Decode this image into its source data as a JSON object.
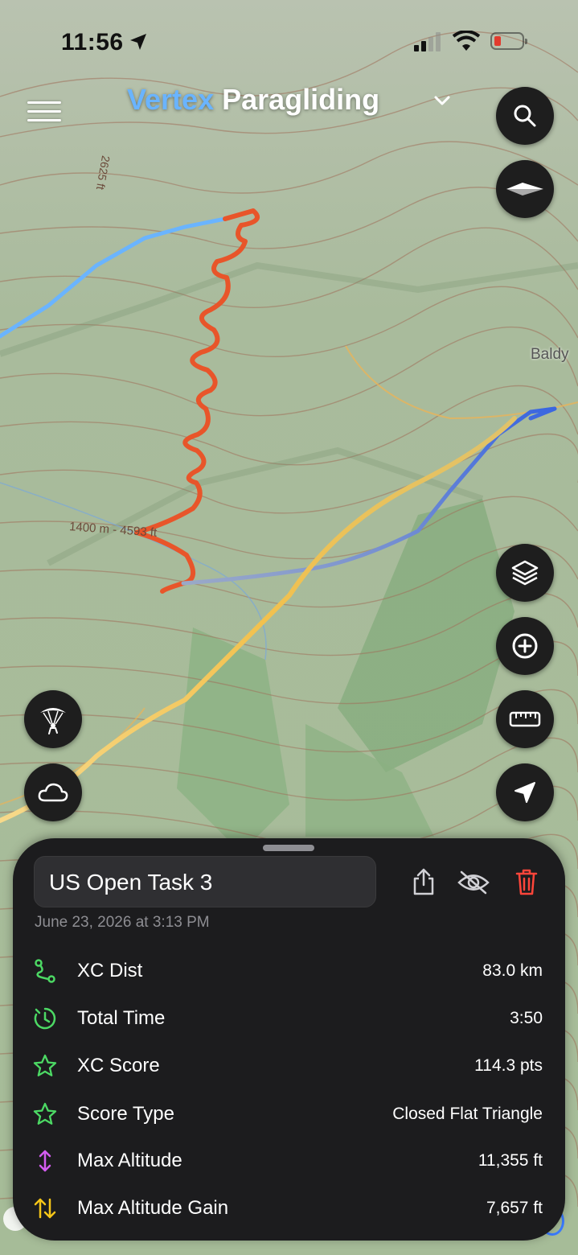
{
  "status_bar": {
    "time": "11:56"
  },
  "header": {
    "brand": "Vertex",
    "product": " Paragliding"
  },
  "map": {
    "place_label": "Baldy",
    "contour_label_1": "1400 m - 4593 ft",
    "contour_label_2": "2625 ft"
  },
  "buttons": {
    "menu": "menu-icon",
    "search": "search-icon",
    "compass": "compass-icon",
    "layers": "layers-icon",
    "add": "plus-circle-icon",
    "measure": "ruler-icon",
    "locate": "location-arrow-icon",
    "pilot": "paraglider-icon",
    "weather": "cloud-icon"
  },
  "sheet": {
    "track_name": "US Open Task 3",
    "date": "June 23, 2026 at 3:13 PM",
    "actions": [
      "share-icon",
      "eye-slash-icon",
      "trash-icon"
    ],
    "stats": [
      {
        "label": "XC Dist",
        "value": "83.0 km",
        "icon": "route-icon",
        "color": "#4cd964"
      },
      {
        "label": "Total Time",
        "value": "3:50",
        "icon": "timer-icon",
        "color": "#4cd964"
      },
      {
        "label": "XC Score",
        "value": "114.3 pts",
        "icon": "star-icon",
        "color": "#4cd964"
      },
      {
        "label": "Score Type",
        "value": "Closed Flat Triangle",
        "icon": "star-icon",
        "color": "#4cd964"
      },
      {
        "label": "Max Altitude",
        "value": "11,355 ft",
        "icon": "vertical-arrows-icon",
        "color": "#d35cf0"
      },
      {
        "label": "Max Altitude Gain",
        "value": "7,657 ft",
        "icon": "up-down-arrows-icon",
        "color": "#f5c518"
      }
    ]
  },
  "colors": {
    "track_climb": "#e8552a",
    "track_glide": "#f2c14e",
    "track_sink": "#4a7be0",
    "track_start": "#6ab4ff",
    "sheet_bg": "#1c1c1e",
    "delete": "#ff453a"
  }
}
